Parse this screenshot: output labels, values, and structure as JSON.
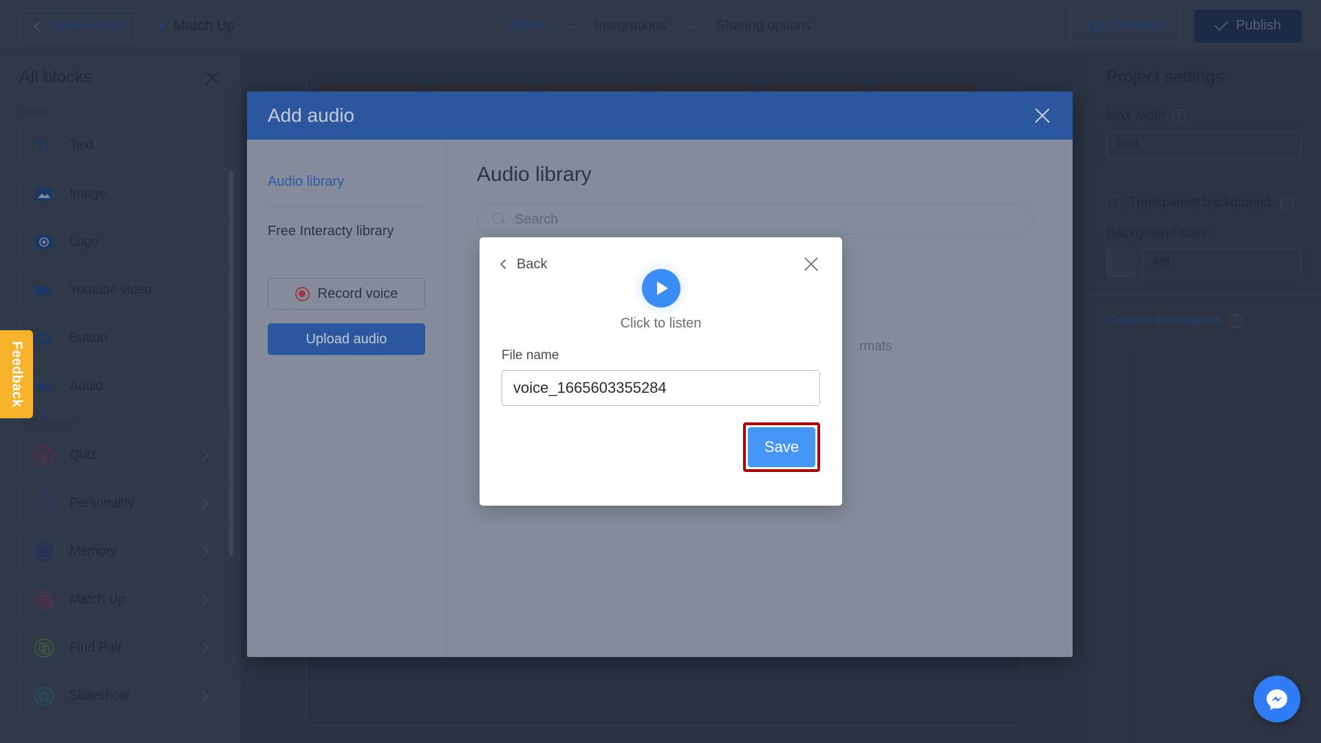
{
  "topbar": {
    "save_exit": "Save & Exit",
    "project_name": "Match Up",
    "breadcrumb": [
      "Editor",
      "Integrations",
      "Sharing options"
    ],
    "breadcrumb_arrow": "→",
    "preview": "Preview",
    "publish": "Publish"
  },
  "sidebar": {
    "title": "All blocks",
    "groups": [
      {
        "label": "Static",
        "items": [
          {
            "label": "Text",
            "icon": "text-icon",
            "chevron": false
          },
          {
            "label": "Image",
            "icon": "image-icon",
            "chevron": false
          },
          {
            "label": "Logo",
            "icon": "logo-icon",
            "chevron": false
          },
          {
            "label": "Youtube video",
            "icon": "video-icon",
            "chevron": false
          },
          {
            "label": "Button",
            "icon": "button-icon",
            "chevron": false
          },
          {
            "label": "Audio",
            "icon": "audio-icon",
            "chevron": false
          }
        ]
      },
      {
        "label": "Interactive",
        "items": [
          {
            "label": "Quiz",
            "icon": "quiz-icon",
            "chevron": true
          },
          {
            "label": "Personality",
            "icon": "personality-icon",
            "chevron": true
          },
          {
            "label": "Memory",
            "icon": "memory-icon",
            "chevron": true
          },
          {
            "label": "Match Up",
            "icon": "matchup-icon",
            "chevron": true
          },
          {
            "label": "Find Pair",
            "icon": "findpair-icon",
            "chevron": true
          },
          {
            "label": "Slideshow",
            "icon": "slideshow-icon",
            "chevron": true
          }
        ]
      }
    ]
  },
  "feedback_tab": {
    "label": "Feedback"
  },
  "right_panel": {
    "title": "Project settings",
    "max_width_label": "Max width",
    "max_width_value": "800",
    "transparent_bg_label": "Transparent background",
    "background_color_label": "Background color",
    "background_color_value": "#fff",
    "custom_translations": "Custom translations"
  },
  "modal": {
    "title": "Add audio",
    "tabs": [
      {
        "label": "Audio library",
        "active": true
      },
      {
        "label": "Free Interacty library",
        "active": false
      }
    ],
    "record_button": "Record voice",
    "upload_button": "Upload audio",
    "content_title": "Audio library",
    "search_placeholder": "Search",
    "formats_hint": "rmats"
  },
  "inner_dialog": {
    "back_label": "Back",
    "listen_label": "Click to listen",
    "file_name_label": "File name",
    "file_name_value": "voice_1665603355284",
    "save_label": "Save"
  },
  "colors": {
    "modal_header_blue": "#2a579e",
    "accent_blue": "#3b8cf5",
    "save_button_blue": "#4596f6",
    "highlight_red": "#aa0000",
    "feedback_yellow": "#f7b32b",
    "messenger_blue": "#2f7cf6"
  }
}
